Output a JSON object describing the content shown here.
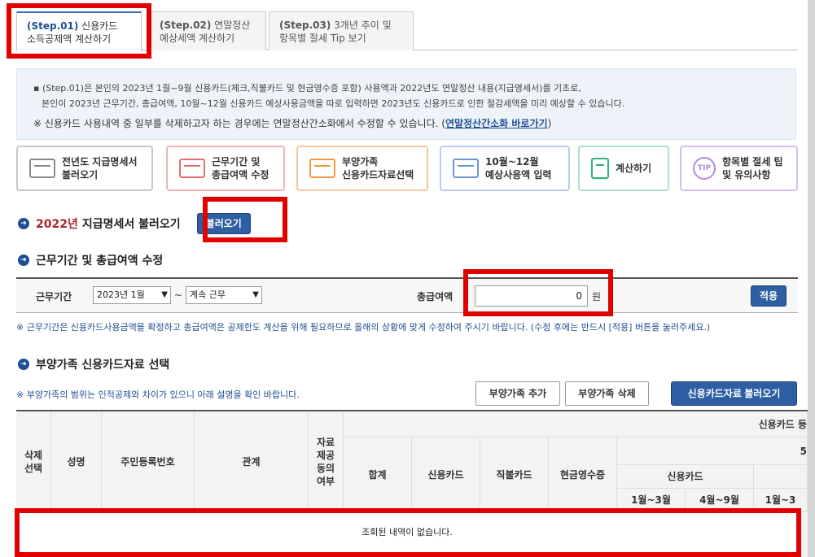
{
  "tabs": [
    {
      "step": "(Step.01)",
      "title1": "신용카드",
      "title2": "소득공제액 계산하기"
    },
    {
      "step": "(Step.02)",
      "title1": "연말정산",
      "title2": "예상세액 계산하기"
    },
    {
      "step": "(Step.03)",
      "title1": "3개년 추이 및",
      "title2": "항목별 절세 Tip 보기"
    }
  ],
  "info": {
    "line1": "▪ (Step.01)은 본인의 2023년 1월~9월 신용카드(체크,직불카드 및 현금영수증 포함) 사용액과 2022년도 연말정산 내용(지급명세서)를 기초로,",
    "line2": "본인이 2023년 근무기간, 총급여액, 10월~12월 신용카드 예상사용금액을 따로 입력하면 2023년도 신용카드로 인한 절감세액을 미리 예상할 수 있습니다.",
    "line3_prefix": "※ 신용카드 사용내역 중 일부를 삭제하고자 하는 경우에는 연말정산간소화에서 수정할 수 있습니다. (",
    "line3_link": "연말정산간소화 바로가기",
    "line3_suffix": ")"
  },
  "steps": [
    {
      "l1": "전년도 지급명세서",
      "l2": "불러오기",
      "icon": "calendar-icon"
    },
    {
      "l1": "근무기간 및",
      "l2": "총급여액 수정",
      "icon": "calendar-grid-icon"
    },
    {
      "l1": "부양가족",
      "l2": "신용카드자료선택",
      "icon": "monitor-icon"
    },
    {
      "l1": "10월~12월",
      "l2": "예상사용액 입력",
      "icon": "credit-card-icon"
    },
    {
      "l1": "계산하기",
      "l2": "",
      "icon": "calculator-icon"
    },
    {
      "l1": "항목별 절세 팁",
      "l2": "및 유의사항",
      "icon": "tip-icon",
      "badge": "TIP"
    }
  ],
  "sec1": {
    "year": "2022년",
    "title": "지급명세서 불러오기",
    "button": "불러오기"
  },
  "sec2": {
    "title": "근무기간 및 총급여액 수정"
  },
  "period": {
    "label": "근무기간",
    "start": "2023년 1월",
    "tilde": "~",
    "end": "계속 근무",
    "salary_label": "총급여액",
    "salary_value": "0",
    "unit": "원",
    "apply": "적용"
  },
  "note1": "※ 근무기간은 신용카드사용금액을 확정하고 총급여액은 공제한도 계산을 위해 필요하므로 올해의 상황에 맞게 수정하여 주시기 바랍니다. (수정 후에는 반드시 [적용] 버튼을 눌러주세요.)",
  "sec3": {
    "title": "부양가족 신용카드자료 선택"
  },
  "note2": "※ 부양가족의 범위는 인적공제와 차이가 있으니 아래 설명을 확인 바랍니다.",
  "buttons": {
    "add": "부양가족 추가",
    "del": "부양가족 삭제",
    "load": "신용카드자료 불러오기"
  },
  "table": {
    "h_delete": "삭제\n선택",
    "h_name": "성명",
    "h_rrn": "주민등록번호",
    "h_rel": "관계",
    "h_provided": "자료\n제공\n동의\n여부",
    "h_group": "신용카드 등",
    "h_total": "합계",
    "h_credit": "신용카드",
    "h_debit": "직불카드",
    "h_cash": "현금영수증",
    "h_five": "5",
    "h_credit2": "신용카드",
    "h_q1": "1월~3월",
    "h_q2": "4월~9월",
    "h_q3": "1월~3",
    "empty": "조회된 내역이 없습니다."
  },
  "colors": {
    "accent": "#2e5fa3",
    "highlight": "#e00000",
    "year": "#b0202a"
  }
}
